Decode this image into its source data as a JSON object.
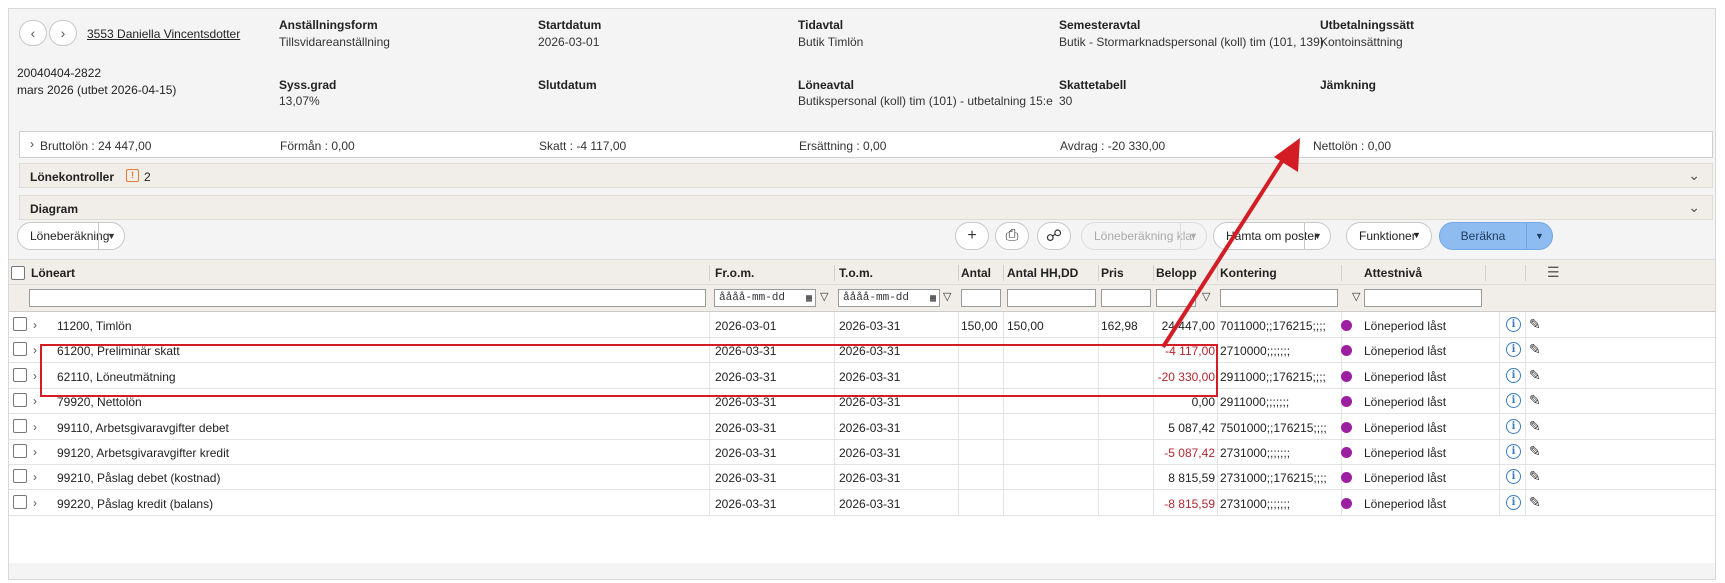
{
  "employee": {
    "link": "3553 Daniella Vincentsdotter",
    "personnummer": "20040404-2822",
    "period": "mars 2026 (utbet 2026-04-15)"
  },
  "fields": {
    "anstallningsform": {
      "label": "Anställningsform",
      "value": "Tillsvidareanställning"
    },
    "startdatum": {
      "label": "Startdatum",
      "value": "2026-03-01"
    },
    "tidavtal": {
      "label": "Tidavtal",
      "value": "Butik Timlön"
    },
    "semesteravtal": {
      "label": "Semesteravtal",
      "value": "Butik - Stormarknadspersonal (koll) tim (101, 139)"
    },
    "utbetalningssatt": {
      "label": "Utbetalningssätt",
      "value": "Kontoinsättning"
    },
    "syssgrad": {
      "label": "Syss.grad",
      "value": "13,07%"
    },
    "slutdatum": {
      "label": "Slutdatum",
      "value": ""
    },
    "loneavtal": {
      "label": "Löneavtal",
      "value": "Butikspersonal (koll) tim (101) - utbetalning 15:e"
    },
    "skattetabell": {
      "label": "Skattetabell",
      "value": "30"
    },
    "jamkning": {
      "label": "Jämkning",
      "value": ""
    }
  },
  "summary": {
    "bruttolon": "Bruttolön : 24 447,00",
    "forman": "Förmån : 0,00",
    "skatt": "Skatt : -4 117,00",
    "ersattning": "Ersättning : 0,00",
    "avdrag": "Avdrag : -20 330,00",
    "nettolon": "Nettolön : 0,00"
  },
  "accordions": {
    "lonekontroller": {
      "title": "Lönekontroller",
      "count": "2"
    },
    "diagram": {
      "title": "Diagram"
    }
  },
  "toolbar": {
    "loneberakning": "Löneberäkning",
    "loneberakning_klar": "Löneberäkning klar",
    "hamta_om_poster": "Hämta om poster",
    "funktioner": "Funktioner",
    "berakna": "Beräkna"
  },
  "columns": {
    "loneart": "Löneart",
    "from": "Fr.o.m.",
    "tom": "T.o.m.",
    "antal": "Antal",
    "antal_hhdd": "Antal HH,DD",
    "pris": "Pris",
    "belopp": "Belopp",
    "kontering": "Kontering",
    "attestniva": "Attestnivå"
  },
  "filters": {
    "date_placeholder": "åååå-mm-dd"
  },
  "rows": [
    {
      "loneart": "11200, Timlön",
      "from": "2026-03-01",
      "tom": "2026-03-31",
      "antal": "150,00",
      "antal_hhdd": "150,00",
      "pris": "162,98",
      "belopp": "24 447,00",
      "negative": false,
      "kontering": "7011000;;176215;;;;",
      "attest": "Löneperiod låst"
    },
    {
      "loneart": "61200, Preliminär skatt",
      "from": "2026-03-31",
      "tom": "2026-03-31",
      "antal": "",
      "antal_hhdd": "",
      "pris": "",
      "belopp": "-4 117,00",
      "negative": true,
      "kontering": "2710000;;;;;;;",
      "attest": "Löneperiod låst"
    },
    {
      "loneart": "62110, Löneutmätning",
      "from": "2026-03-31",
      "tom": "2026-03-31",
      "antal": "",
      "antal_hhdd": "",
      "pris": "",
      "belopp": "-20 330,00",
      "negative": true,
      "kontering": "2911000;;176215;;;;",
      "attest": "Löneperiod låst"
    },
    {
      "loneart": "79920, Nettolön",
      "from": "2026-03-31",
      "tom": "2026-03-31",
      "antal": "",
      "antal_hhdd": "",
      "pris": "",
      "belopp": "0,00",
      "negative": false,
      "kontering": "2911000;;;;;;;",
      "attest": "Löneperiod låst"
    },
    {
      "loneart": "99110, Arbetsgivaravgifter debet",
      "from": "2026-03-31",
      "tom": "2026-03-31",
      "antal": "",
      "antal_hhdd": "",
      "pris": "",
      "belopp": "5 087,42",
      "negative": false,
      "kontering": "7501000;;176215;;;;",
      "attest": "Löneperiod låst"
    },
    {
      "loneart": "99120, Arbetsgivaravgifter kredit",
      "from": "2026-03-31",
      "tom": "2026-03-31",
      "antal": "",
      "antal_hhdd": "",
      "pris": "",
      "belopp": "-5 087,42",
      "negative": true,
      "kontering": "2731000;;;;;;;",
      "attest": "Löneperiod låst"
    },
    {
      "loneart": "99210, Påslag debet (kostnad)",
      "from": "2026-03-31",
      "tom": "2026-03-31",
      "antal": "",
      "antal_hhdd": "",
      "pris": "",
      "belopp": "8 815,59",
      "negative": false,
      "kontering": "2731000;;176215;;;;",
      "attest": "Löneperiod låst"
    },
    {
      "loneart": "99220, Påslag kredit (balans)",
      "from": "2026-03-31",
      "tom": "2026-03-31",
      "antal": "",
      "antal_hhdd": "",
      "pris": "",
      "belopp": "-8 815,59",
      "negative": true,
      "kontering": "2731000;;;;;;;",
      "attest": "Löneperiod låst"
    }
  ],
  "colors": {
    "negative": "#b3262e",
    "attest_dot": "#9b1fa0",
    "annotation": "#d41c24",
    "primary": "#8fbcf0"
  }
}
